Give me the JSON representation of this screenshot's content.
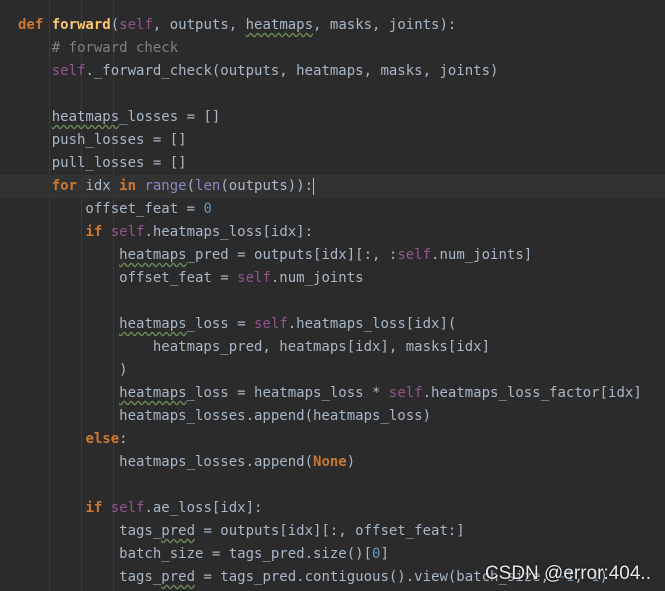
{
  "editor": {
    "lines": [
      [
        {
          "t": "def ",
          "c": "kw"
        },
        {
          "t": "forward",
          "c": "fn"
        },
        {
          "t": "(",
          "c": "pl"
        },
        {
          "t": "self",
          "c": "slf"
        },
        {
          "t": ", outputs, ",
          "c": "pl"
        },
        {
          "t": "heatmaps",
          "c": "pl",
          "u": true
        },
        {
          "t": ", masks, joints):",
          "c": "pl"
        }
      ],
      [
        {
          "t": "    # forward check",
          "c": "cm"
        }
      ],
      [
        {
          "t": "    ",
          "c": "pl"
        },
        {
          "t": "self",
          "c": "slf"
        },
        {
          "t": "._forward_check(outputs, heatmaps, masks, joints)",
          "c": "pl"
        }
      ],
      [],
      [
        {
          "t": "    ",
          "c": "pl"
        },
        {
          "t": "heatmaps",
          "c": "pl",
          "u": true
        },
        {
          "t": "_losses = []",
          "c": "pl"
        }
      ],
      [
        {
          "t": "    push_losses = []",
          "c": "pl"
        }
      ],
      [
        {
          "t": "    pull_losses = []",
          "c": "pl"
        }
      ],
      [
        {
          "t": "    ",
          "c": "pl"
        },
        {
          "t": "for ",
          "c": "kw"
        },
        {
          "t": "idx ",
          "c": "pl"
        },
        {
          "t": "in ",
          "c": "kw"
        },
        {
          "t": "range",
          "c": "bi"
        },
        {
          "t": "(",
          "c": "pl"
        },
        {
          "t": "len",
          "c": "bi"
        },
        {
          "t": "(outputs)):",
          "c": "pl"
        }
      ],
      [
        {
          "t": "        offset_feat = ",
          "c": "pl"
        },
        {
          "t": "0",
          "c": "num"
        }
      ],
      [
        {
          "t": "        ",
          "c": "pl"
        },
        {
          "t": "if ",
          "c": "kw"
        },
        {
          "t": "self",
          "c": "slf"
        },
        {
          "t": ".heatmaps_loss[idx]:",
          "c": "pl"
        }
      ],
      [
        {
          "t": "            ",
          "c": "pl"
        },
        {
          "t": "heatmaps",
          "c": "pl",
          "u": true
        },
        {
          "t": "_pred = outputs[idx][:, :",
          "c": "pl"
        },
        {
          "t": "self",
          "c": "slf"
        },
        {
          "t": ".num_joints]",
          "c": "pl"
        }
      ],
      [
        {
          "t": "            offset_feat = ",
          "c": "pl"
        },
        {
          "t": "self",
          "c": "slf"
        },
        {
          "t": ".num_joints",
          "c": "pl"
        }
      ],
      [],
      [
        {
          "t": "            ",
          "c": "pl"
        },
        {
          "t": "heatmaps",
          "c": "pl",
          "u": true
        },
        {
          "t": "_loss = ",
          "c": "pl"
        },
        {
          "t": "self",
          "c": "slf"
        },
        {
          "t": ".heatmaps_loss[idx](",
          "c": "pl"
        }
      ],
      [
        {
          "t": "                heatmaps_pred, heatmaps[idx], masks[idx]",
          "c": "pl"
        }
      ],
      [
        {
          "t": "            )",
          "c": "pl"
        }
      ],
      [
        {
          "t": "            ",
          "c": "pl"
        },
        {
          "t": "heatmaps",
          "c": "pl",
          "u": true
        },
        {
          "t": "_loss = heatmaps_loss * ",
          "c": "pl"
        },
        {
          "t": "self",
          "c": "slf"
        },
        {
          "t": ".heatmaps_loss_factor[idx]",
          "c": "pl"
        }
      ],
      [
        {
          "t": "            heatmaps_losses.append(heatmaps_loss)",
          "c": "pl"
        }
      ],
      [
        {
          "t": "        ",
          "c": "pl"
        },
        {
          "t": "else",
          "c": "kw"
        },
        {
          "t": ":",
          "c": "pl"
        }
      ],
      [
        {
          "t": "            heatmaps_losses.append(",
          "c": "pl"
        },
        {
          "t": "None",
          "c": "kw"
        },
        {
          "t": ")",
          "c": "pl"
        }
      ],
      [],
      [
        {
          "t": "        ",
          "c": "pl"
        },
        {
          "t": "if ",
          "c": "kw"
        },
        {
          "t": "self",
          "c": "slf"
        },
        {
          "t": ".ae_loss[idx]:",
          "c": "pl"
        }
      ],
      [
        {
          "t": "            tags_",
          "c": "pl"
        },
        {
          "t": "pred",
          "c": "pl",
          "u": true
        },
        {
          "t": " = outputs[idx][:, offset_feat:]",
          "c": "pl"
        }
      ],
      [
        {
          "t": "            batch_size = tags_pred.size()[",
          "c": "pl"
        },
        {
          "t": "0",
          "c": "num"
        },
        {
          "t": "]",
          "c": "pl"
        }
      ],
      [
        {
          "t": "            tags_",
          "c": "pl"
        },
        {
          "t": "pred",
          "c": "pl",
          "u": true
        },
        {
          "t": " = tags_pred.contiguous().view(batch_size, ",
          "c": "pl"
        },
        {
          "t": "-1",
          "c": "num"
        },
        {
          "t": ", ",
          "c": "pl"
        },
        {
          "t": "1",
          "c": "num"
        },
        {
          "t": ")",
          "c": "pl"
        }
      ]
    ],
    "current_line_index": 7
  },
  "watermark": {
    "text": "CSDN @error:404.."
  },
  "colors": {
    "background": "#2b2b2b",
    "current_line": "#323232",
    "keyword": "#cc7832",
    "function_name": "#ffc66d",
    "self": "#94558d",
    "comment": "#808080",
    "number": "#6897bb",
    "builtin": "#8888c6",
    "plain": "#a9b7c6"
  }
}
